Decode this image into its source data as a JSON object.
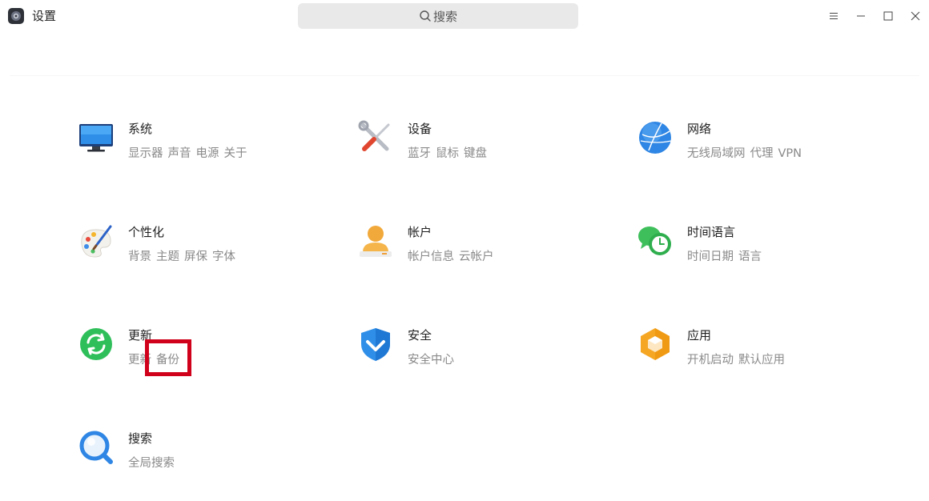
{
  "window": {
    "title": "设置",
    "search_placeholder": "搜索",
    "icons": [
      "settings-app-icon",
      "search-icon",
      "menu-icon",
      "minimize-icon",
      "maximize-icon",
      "close-icon"
    ]
  },
  "categories": [
    {
      "name": "系统",
      "desc": [
        "显示器",
        "声音",
        "电源",
        "关于"
      ],
      "icon": "monitor-icon"
    },
    {
      "name": "设备",
      "desc": [
        "蓝牙",
        "鼠标",
        "键盘"
      ],
      "icon": "tools-icon"
    },
    {
      "name": "网络",
      "desc": [
        "无线局域网",
        "代理",
        "VPN"
      ],
      "icon": "globe-icon"
    },
    {
      "name": "个性化",
      "desc": [
        "背景",
        "主题",
        "屏保",
        "字体"
      ],
      "icon": "palette-icon"
    },
    {
      "name": "帐户",
      "desc": [
        "帐户信息",
        "云帐户"
      ],
      "icon": "user-icon"
    },
    {
      "name": "时间语言",
      "desc": [
        "时间日期",
        "语言"
      ],
      "icon": "chat-clock-icon"
    },
    {
      "name": "更新",
      "desc": [
        "更新",
        "备份"
      ],
      "icon": "refresh-icon"
    },
    {
      "name": "安全",
      "desc": [
        "安全中心"
      ],
      "icon": "shield-icon"
    },
    {
      "name": "应用",
      "desc": [
        "开机启动",
        "默认应用"
      ],
      "icon": "app-hexagon-icon"
    },
    {
      "name": "搜索",
      "desc": [
        "全局搜索"
      ],
      "icon": "magnifier-icon"
    }
  ],
  "colors": {
    "highlight": "#d0021b",
    "desc_text": "#8a8a8a",
    "search_bg": "#e9e9e9"
  }
}
